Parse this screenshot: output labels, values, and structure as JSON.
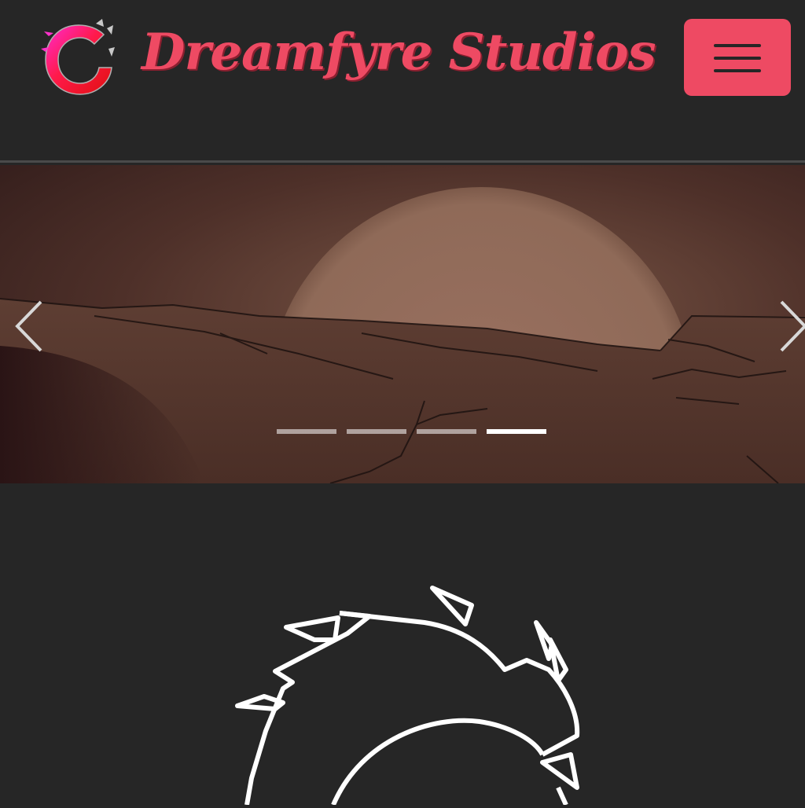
{
  "navbar": {
    "brand_title": "Dreamfyre Studios",
    "logo_icon": "dragon-ring-logo-icon",
    "menu_icon": "hamburger-menu-icon",
    "accent_color": "#ee4a63",
    "background_color": "#262626"
  },
  "carousel": {
    "slide_image": "desert-sunset-slide",
    "prev_icon": "chevron-left-icon",
    "next_icon": "chevron-right-icon",
    "slide_count": 4,
    "active_slide": 4
  },
  "hero": {
    "logo_icon": "dragon-ring-outline-icon"
  }
}
